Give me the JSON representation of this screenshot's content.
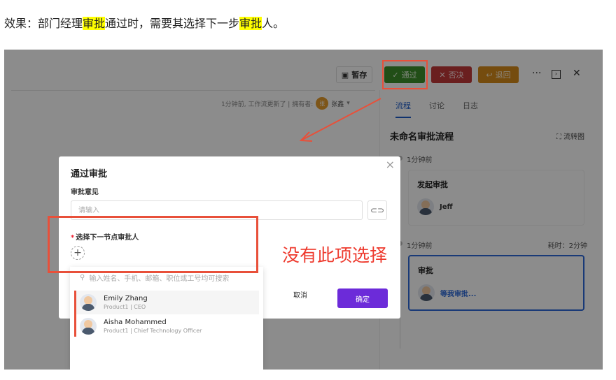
{
  "caption": {
    "part1": "效果：部门经理",
    "hl1": "审批",
    "part2": "通过时，需要其选择下一步",
    "hl2": "审批",
    "part3": "人。"
  },
  "toolbar": {
    "save_label": "暂存",
    "pass_label": "通过",
    "reject_label": "否决",
    "back_label": "退回",
    "more_icon": "more-icon",
    "collapse_icon": "collapse-icon",
    "close_icon": "close-icon"
  },
  "left": {
    "meta_text": "1分钟前, 工作流更新了 | 拥有者:",
    "owner_avatar": "张",
    "owner_name": "张鑫"
  },
  "right": {
    "tabs": [
      "流程",
      "讨论",
      "日志"
    ],
    "flow_title": "未命名审批流程",
    "flow_chart_label": "流转图",
    "step1_time": "1分钟前",
    "step1_title": "发起审批",
    "step1_person": "Jeff",
    "step2_time": "1分钟前",
    "step2_elapsed": "耗时：2分钟",
    "step2_title": "审批",
    "step2_person": "等我审批..."
  },
  "modal": {
    "title": "通过审批",
    "opinion_label": "审批意见",
    "opinion_placeholder": "请输入",
    "opinion_value": "",
    "next_label": "选择下一节点审批人",
    "cancel_label": "取消",
    "ok_label": "确定"
  },
  "dropdown": {
    "search_placeholder": "输入姓名、手机、邮箱、职位或工号均可搜索",
    "items": [
      {
        "name": "Emily Zhang",
        "sub": "Product1 | CEO"
      },
      {
        "name": "Aisha Mohammed",
        "sub": "Product1 | Chief Technology Officer"
      }
    ]
  },
  "annotation": {
    "text": "没有此项选择"
  },
  "colors": {
    "accent_red": "#e8503a",
    "pass_green": "#3c8f2a",
    "ok_purple": "#6c2bd9",
    "active_blue": "#2f6bd9"
  }
}
